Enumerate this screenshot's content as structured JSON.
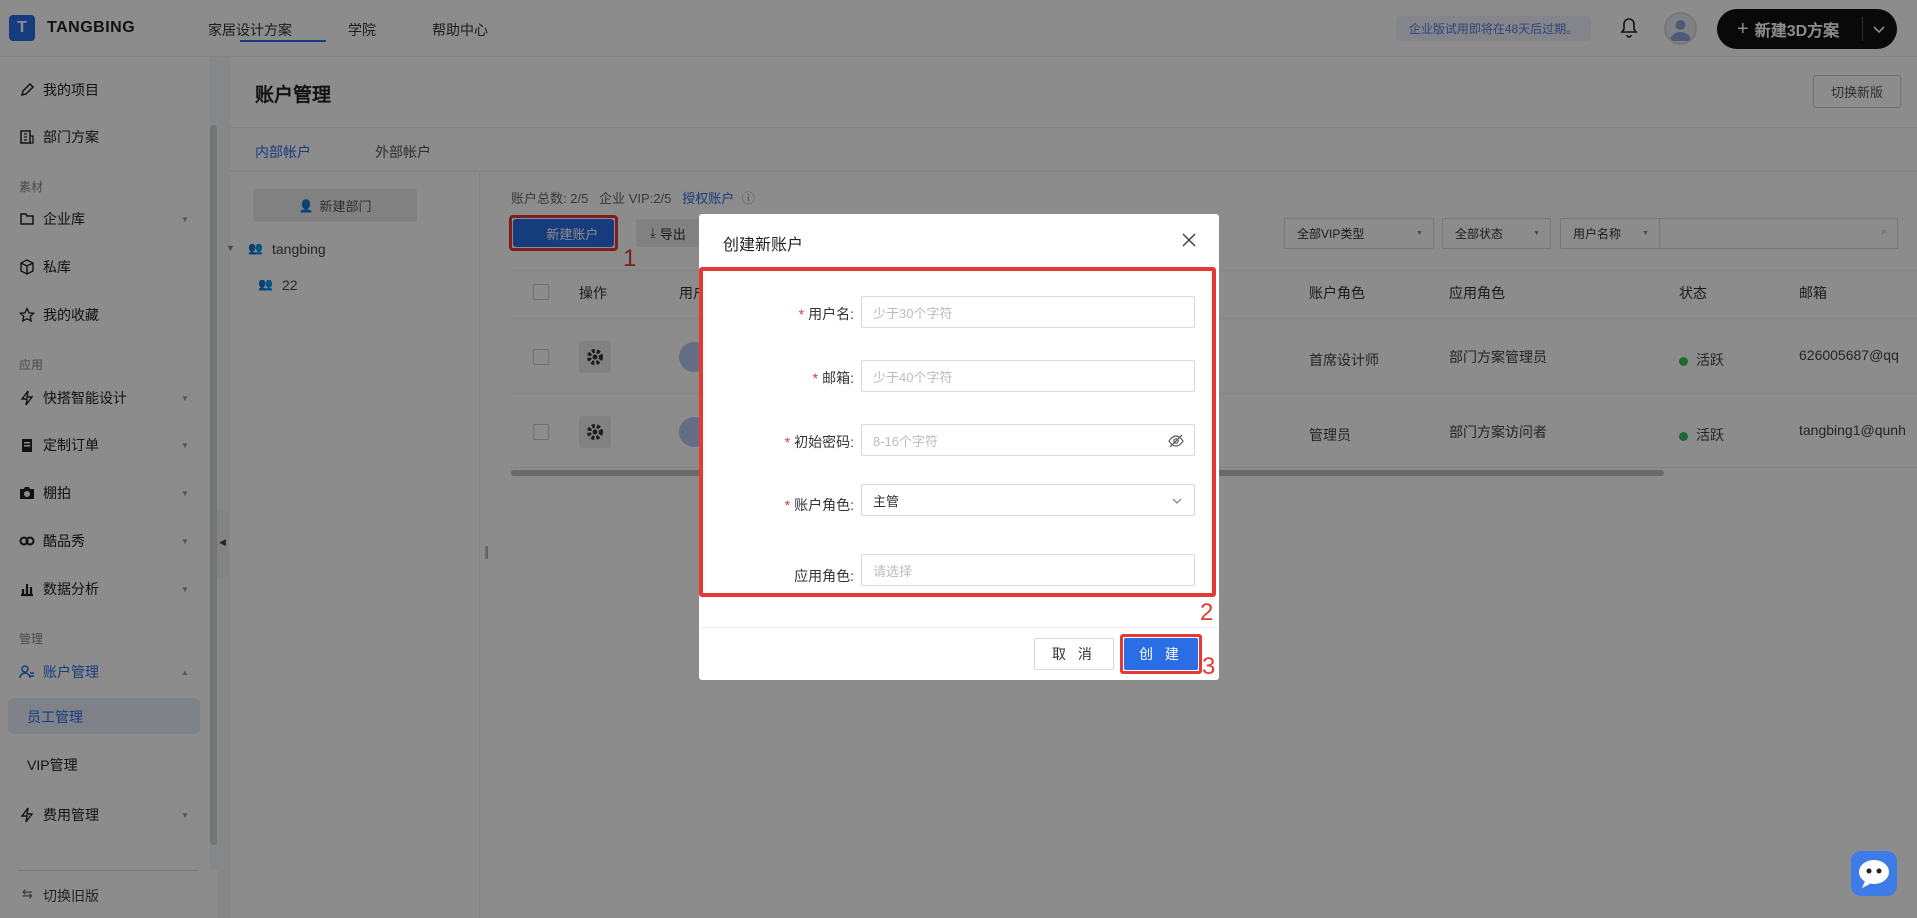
{
  "topbar": {
    "logo_letter": "T",
    "brand": "TANGBING",
    "nav": [
      "家居设计方案",
      "学院",
      "帮助中心"
    ],
    "trial_notice": "企业版试用即将在48天后过期。",
    "new_button": "新建3D方案"
  },
  "sidebar": {
    "my_projects": "我的项目",
    "dept_plans": "部门方案",
    "section_material": "素材",
    "enterprise_lib": "企业库",
    "private_lib": "私库",
    "favorites": "我的收藏",
    "section_apps": "应用",
    "quick_design": "快搭智能设计",
    "custom_orders": "定制订单",
    "studio_shoot": "棚拍",
    "kuxiu": "酷品秀",
    "analytics": "数据分析",
    "section_manage": "管理",
    "account_mgmt": "账户管理",
    "staff_mgmt": "员工管理",
    "vip_mgmt": "VIP管理",
    "billing": "费用管理",
    "switch_old": "切换旧版"
  },
  "page": {
    "title": "账户管理",
    "switch_new": "切换新版",
    "tabs": [
      "内部帐户",
      "外部帐户"
    ]
  },
  "tree": {
    "new_dept": "新建部门",
    "root": "tangbing",
    "child": "22"
  },
  "toolbar": {
    "stats_prefix": "账户总数: 2/5",
    "stats_vip": "企业 VIP:2/5",
    "authorize_link": "授权账户",
    "new_account": "新建账户",
    "export": "导出",
    "filter_vip": "全部VIP类型",
    "filter_status": "全部状态",
    "filter_field": "用户名称"
  },
  "table": {
    "headers": [
      "操作",
      "用户",
      "账户角色",
      "应用角色",
      "状态",
      "邮箱"
    ],
    "rows": [
      {
        "account_role": "首席设计师",
        "app_role": "部门方案管理员",
        "status": "活跃",
        "email": "626005687@qq"
      },
      {
        "account_role": "管理员",
        "app_role": "部门方案访问者",
        "status": "活跃",
        "email": "tangbing1@qunh"
      }
    ]
  },
  "modal": {
    "title": "创建新账户",
    "fields": [
      {
        "label": "用户名:",
        "required": true,
        "placeholder": "少于30个字符"
      },
      {
        "label": "邮箱:",
        "required": true,
        "placeholder": "少于40个字符"
      },
      {
        "label": "初始密码:",
        "required": true,
        "placeholder": "8-16个字符"
      },
      {
        "label": "账户角色:",
        "required": true,
        "value": "主管"
      },
      {
        "label": "应用角色:",
        "required": false,
        "placeholder": "请选择"
      }
    ],
    "cancel": "取 消",
    "create": "创 建"
  },
  "annotations": [
    "1",
    "2",
    "3"
  ],
  "colors": {
    "primary": "#2b6de5",
    "annotation_red": "#e53935",
    "status_green": "#34c05a"
  }
}
